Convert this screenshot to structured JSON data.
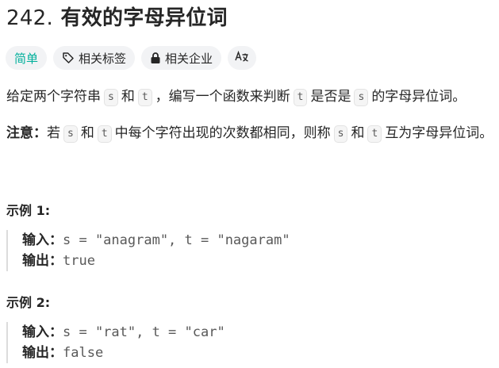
{
  "problem": {
    "number": "242.",
    "title": "有效的字母异位词"
  },
  "tags": {
    "difficulty": "简单",
    "topics": "相关标签",
    "companies": "相关企业",
    "lang_icon": "translate-icon"
  },
  "description": {
    "p1": [
      "给定两个字符串",
      "s",
      "和",
      "t",
      "，编写一个函数来判断",
      "t",
      "是否是",
      "s",
      "的字母异位词。"
    ],
    "note_label": "注意：",
    "p2": [
      "若",
      "s",
      "和",
      "t",
      "中每个字符出现的次数都相同，则称",
      "s",
      "和",
      "t",
      "互为字母异位词。"
    ]
  },
  "examples": [
    {
      "title": "示例 1:",
      "input_label": "输入：",
      "input": "s = \"anagram\", t = \"nagaram\"",
      "output_label": "输出：",
      "output": "true"
    },
    {
      "title": "示例 2:",
      "input_label": "输入：",
      "input": "s = \"rat\", t = \"car\"",
      "output_label": "输出：",
      "output": "false"
    }
  ]
}
